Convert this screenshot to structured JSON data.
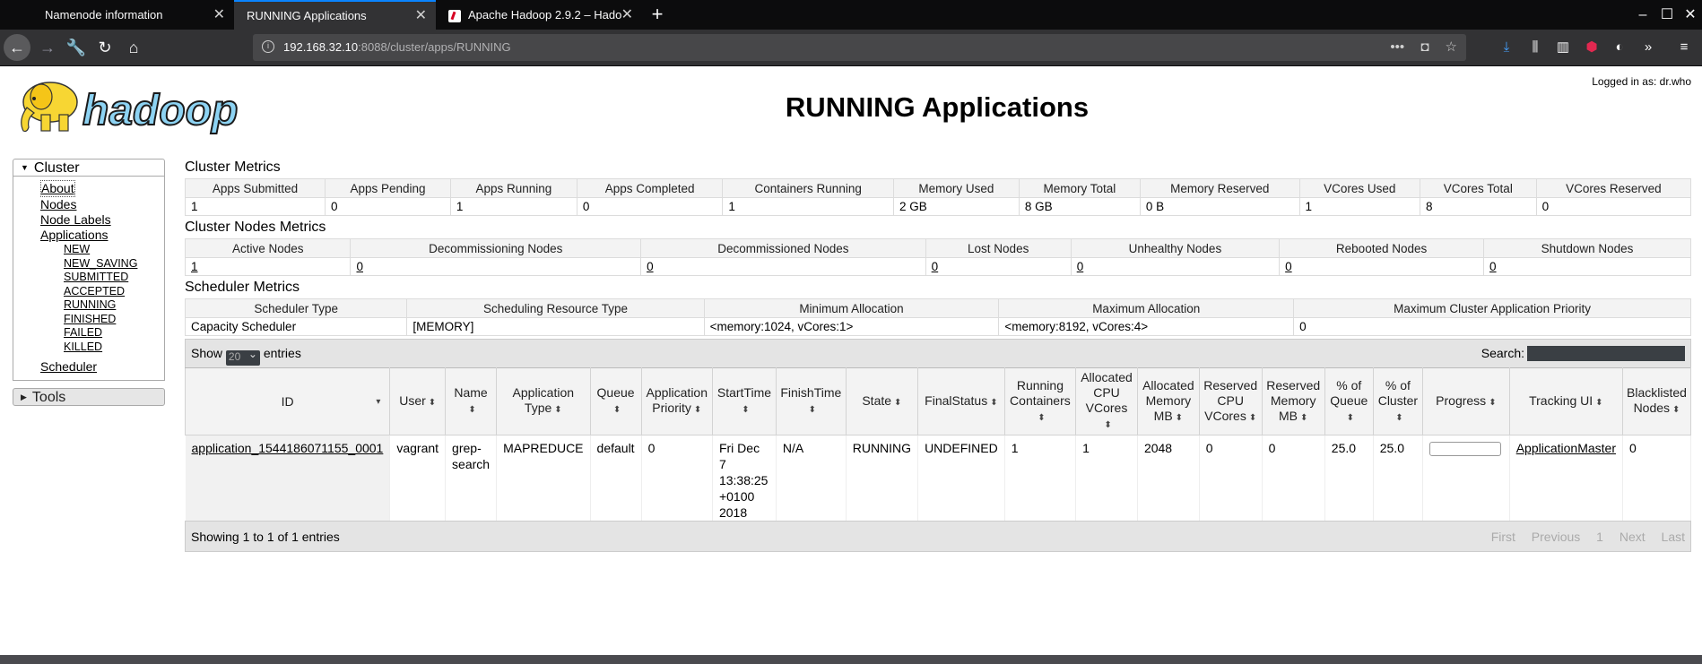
{
  "browser": {
    "tabs": [
      {
        "title": "Namenode information"
      },
      {
        "title": "RUNNING Applications"
      },
      {
        "title": "Apache Hadoop 2.9.2 – Hado"
      }
    ],
    "url_host": "192.168.32.10",
    "url_path": ":8088/cluster/apps/RUNNING"
  },
  "header": {
    "logo_text": "hadoop",
    "logged_in": "Logged in as: dr.who",
    "title": "RUNNING Applications"
  },
  "sidebar": {
    "cluster_label": "Cluster",
    "links": [
      "About",
      "Nodes",
      "Node Labels",
      "Applications"
    ],
    "states": [
      "NEW",
      "NEW_SAVING",
      "SUBMITTED",
      "ACCEPTED",
      "RUNNING",
      "FINISHED",
      "FAILED",
      "KILLED"
    ],
    "scheduler": "Scheduler",
    "tools_label": "Tools"
  },
  "cluster_metrics": {
    "title": "Cluster Metrics",
    "headers": [
      "Apps Submitted",
      "Apps Pending",
      "Apps Running",
      "Apps Completed",
      "Containers Running",
      "Memory Used",
      "Memory Total",
      "Memory Reserved",
      "VCores Used",
      "VCores Total",
      "VCores Reserved"
    ],
    "values": [
      "1",
      "0",
      "1",
      "0",
      "1",
      "2 GB",
      "8 GB",
      "0 B",
      "1",
      "8",
      "0"
    ]
  },
  "nodes_metrics": {
    "title": "Cluster Nodes Metrics",
    "headers": [
      "Active Nodes",
      "Decommissioning Nodes",
      "Decommissioned Nodes",
      "Lost Nodes",
      "Unhealthy Nodes",
      "Rebooted Nodes",
      "Shutdown Nodes"
    ],
    "values": [
      "1",
      "0",
      "0",
      "0",
      "0",
      "0",
      "0"
    ]
  },
  "scheduler_metrics": {
    "title": "Scheduler Metrics",
    "headers": [
      "Scheduler Type",
      "Scheduling Resource Type",
      "Minimum Allocation",
      "Maximum Allocation",
      "Maximum Cluster Application Priority"
    ],
    "values": [
      "Capacity Scheduler",
      "[MEMORY]",
      "<memory:1024, vCores:1>",
      "<memory:8192, vCores:4>",
      "0"
    ]
  },
  "apps_table": {
    "show_label": "Show",
    "entries_label": "entries",
    "page_size": "20",
    "search_label": "Search:",
    "headers": [
      "ID",
      "User",
      "Name",
      "Application Type",
      "Queue",
      "Application Priority",
      "StartTime",
      "FinishTime",
      "State",
      "FinalStatus",
      "Running Containers",
      "Allocated CPU VCores",
      "Allocated Memory MB",
      "Reserved CPU VCores",
      "Reserved Memory MB",
      "% of Queue",
      "% of Cluster",
      "Progress",
      "Tracking UI",
      "Blacklisted Nodes"
    ],
    "row": {
      "id": "application_1544186071155_0001",
      "user": "vagrant",
      "name": "grep-search",
      "type": "MAPREDUCE",
      "queue": "default",
      "priority": "0",
      "start": "Fri Dec 7 13:38:25 +0100 2018",
      "finish": "N/A",
      "state": "RUNNING",
      "final": "UNDEFINED",
      "running_containers": "1",
      "alloc_vcores": "1",
      "alloc_mem": "2048",
      "res_vcores": "0",
      "res_mem": "0",
      "pct_queue": "25.0",
      "pct_cluster": "25.0",
      "progress": 0,
      "tracking": "ApplicationMaster",
      "blacklisted": "0"
    },
    "footer_info": "Showing 1 to 1 of 1 entries",
    "pager": [
      "First",
      "Previous",
      "1",
      "Next",
      "Last"
    ]
  }
}
